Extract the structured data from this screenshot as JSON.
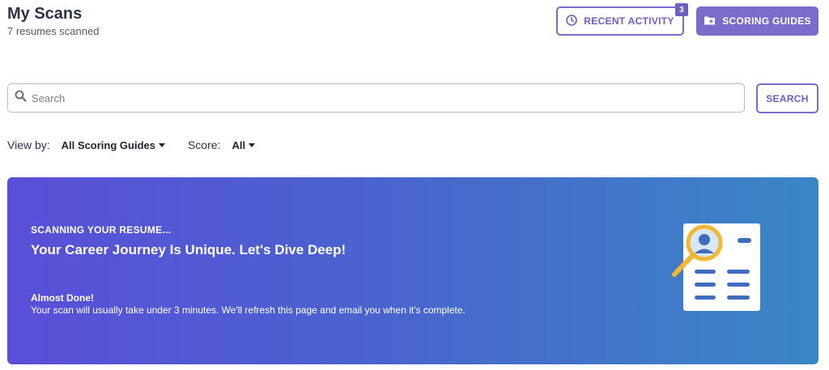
{
  "header": {
    "title": "My Scans",
    "subtitle": "7 resumes scanned"
  },
  "actions": {
    "recent_activity_label": "RECENT ACTIVITY",
    "recent_activity_count": "3",
    "scoring_guides_label": "SCORING GUIDES"
  },
  "search": {
    "placeholder": "Search",
    "value": "",
    "button_label": "SEARCH"
  },
  "filters": {
    "view_by_label": "View by:",
    "view_by_value": "All Scoring Guides",
    "score_label": "Score:",
    "score_value": "All"
  },
  "banner": {
    "kicker": "SCANNING YOUR RESUME...",
    "headline": "Your Career Journey Is Unique. Let's Dive Deep!",
    "status_title": "Almost Done!",
    "status_message": "Your scan will usually take under 3 minutes. We'll refresh this page and email you when it's complete."
  },
  "colors": {
    "accent": "#7b6ccc",
    "banner_start": "#5a4fd8",
    "banner_end": "#3a86c4",
    "magnifier": "#f2b632"
  },
  "icons": {
    "recent_activity": "clock-icon",
    "scoring_guides": "folder-star-icon",
    "search": "search-icon",
    "illustration": "resume-magnifier-icon"
  }
}
